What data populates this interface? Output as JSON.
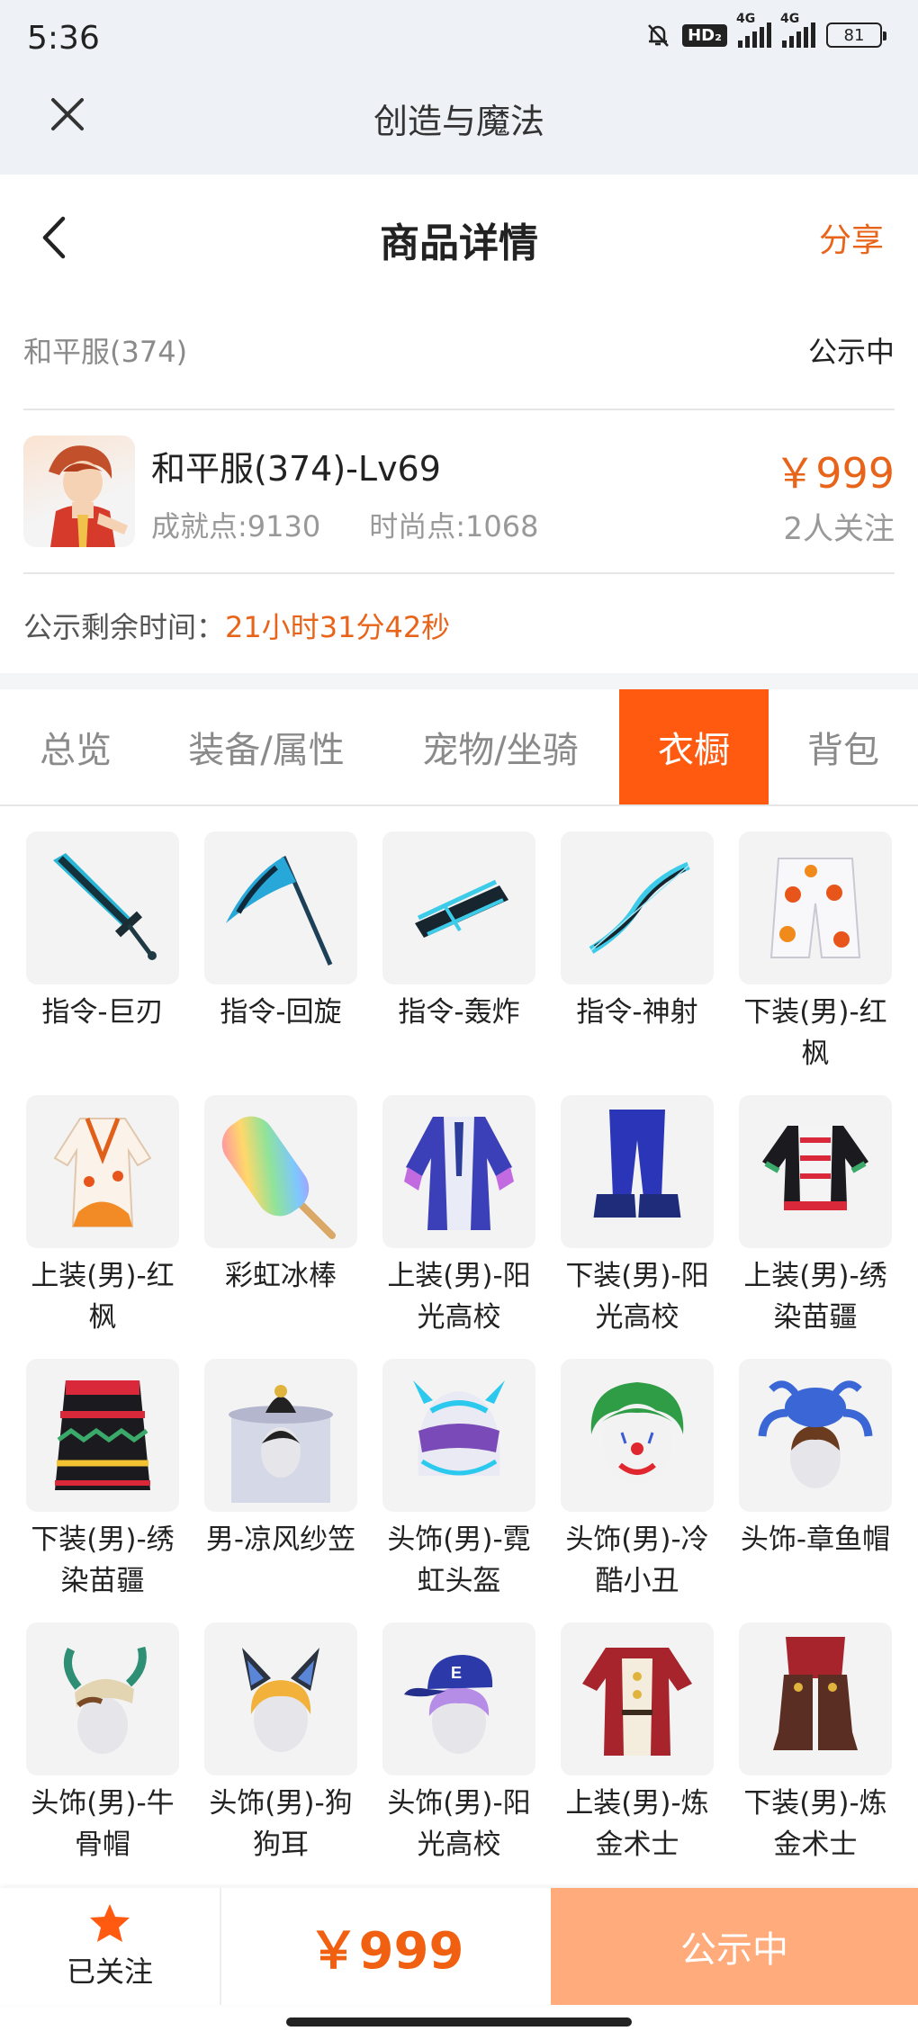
{
  "status_bar": {
    "time": "5:36",
    "hd_badge": "HD₂",
    "network_1": "4G",
    "network_2": "4G",
    "battery": "81"
  },
  "app_bar": {
    "title": "创造与魔法",
    "close_icon": "close-icon"
  },
  "header": {
    "title": "商品详情",
    "share_label": "分享",
    "back_icon": "chevron-left-icon"
  },
  "listing": {
    "server": "和平服(374)",
    "status": "公示中",
    "item_title": "和平服(374)-Lv69",
    "achievement": "成就点:9130",
    "fashion": "时尚点:1068",
    "price": "￥999",
    "followers": "2人关注",
    "timer_label": "公示剩余时间：",
    "timer_value": "21小时31分42秒"
  },
  "tabs": [
    {
      "label": "总览",
      "active": false
    },
    {
      "label": "装备/属性",
      "active": false
    },
    {
      "label": "宠物/坐骑",
      "active": false
    },
    {
      "label": "衣橱",
      "active": true
    },
    {
      "label": "背包",
      "active": false
    }
  ],
  "wardrobe": [
    {
      "label": "指令-巨刃",
      "icon": "cyan-greatsword"
    },
    {
      "label": "指令-回旋",
      "icon": "cyan-scythe"
    },
    {
      "label": "指令-轰炸",
      "icon": "cyan-cannon"
    },
    {
      "label": "指令-神射",
      "icon": "cyan-bow"
    },
    {
      "label": "下装(男)-红枫",
      "icon": "maple-shorts"
    },
    {
      "label": "上装(男)-红枫",
      "icon": "maple-robe"
    },
    {
      "label": "彩虹冰棒",
      "icon": "rainbow-popsicle"
    },
    {
      "label": "上装(男)-阳光高校",
      "icon": "school-jacket"
    },
    {
      "label": "下装(男)-阳光高校",
      "icon": "blue-pants-sneakers"
    },
    {
      "label": "上装(男)-绣染苗疆",
      "icon": "miao-embroidered-top"
    },
    {
      "label": "下装(男)-绣染苗疆",
      "icon": "miao-embroidered-skirt"
    },
    {
      "label": "男-凉风纱笠",
      "icon": "veiled-hat"
    },
    {
      "label": "头饰(男)-霓虹头盔",
      "icon": "neon-helmet"
    },
    {
      "label": "头饰(男)-冷酷小丑",
      "icon": "joker-head"
    },
    {
      "label": "头饰-章鱼帽",
      "icon": "octopus-hat"
    },
    {
      "label": "头饰(男)-牛骨帽",
      "icon": "bull-skull-hat"
    },
    {
      "label": "头饰(男)-狗狗耳",
      "icon": "dog-ears"
    },
    {
      "label": "头饰(男)-阳光高校",
      "icon": "school-cap"
    },
    {
      "label": "上装(男)-炼金术士",
      "icon": "alchemist-coat"
    },
    {
      "label": "下装(男)-炼金术士",
      "icon": "alchemist-boots"
    }
  ],
  "bottom_bar": {
    "follow_label": "已关注",
    "follow_icon": "star-icon",
    "price": "￥999",
    "status_button": "公示中"
  },
  "colors": {
    "accent": "#ff5a10",
    "price": "#e8641a",
    "status_button": "#ffab7c",
    "topbar_bg": "#eef2f6"
  }
}
